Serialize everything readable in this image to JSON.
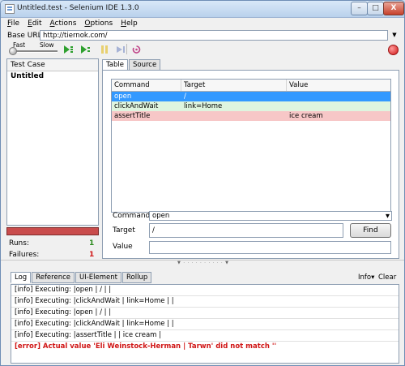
{
  "window": {
    "title": "Untitled.test - Selenium IDE 1.3.0",
    "min": "–",
    "max": "□",
    "close": "X"
  },
  "menu": [
    {
      "accel": "F",
      "rest": "ile"
    },
    {
      "accel": "E",
      "rest": "dit"
    },
    {
      "accel": "A",
      "rest": "ctions"
    },
    {
      "accel": "O",
      "rest": "ptions"
    },
    {
      "accel": "H",
      "rest": "elp"
    }
  ],
  "base_url": {
    "label": "Base URL",
    "value": "http://tiernok.com/"
  },
  "toolbar": {
    "speed_fast": "Fast",
    "speed_slow": "Slow",
    "speed_level": 0
  },
  "test_case": {
    "header": "Test Case",
    "items": [
      "Untitled"
    ]
  },
  "stats": {
    "runs_label": "Runs:",
    "runs": "1",
    "failures_label": "Failures:",
    "failures": "1"
  },
  "editor_tabs": [
    "Table",
    "Source"
  ],
  "table": {
    "headers": [
      "Command",
      "Target",
      "Value"
    ],
    "rows": [
      {
        "command": "open",
        "target": "/",
        "value": ""
      },
      {
        "command": "clickAndWait",
        "target": "link=Home",
        "value": ""
      },
      {
        "command": "assertTitle",
        "target": "",
        "value": "ice cream"
      }
    ]
  },
  "fields": {
    "command_label": "Command",
    "command_value": "open",
    "target_label": "Target",
    "target_value": "/",
    "value_label": "Value",
    "find": "Find"
  },
  "bottom_tabs": [
    "Log",
    "Reference",
    "UI-Element",
    "Rollup"
  ],
  "bottom_controls": {
    "info": "Info▾",
    "clear": "Clear"
  },
  "log": [
    "[info] Executing: |open | / | |",
    "[info] Executing: |clickAndWait | link=Home | |",
    "[info] Executing: |open | / | |",
    "[info] Executing: |clickAndWait | link=Home | |",
    "[info] Executing: |assertTitle | | ice cream |",
    "[error] Actual value 'Eli Weinstock-Herman | Tarwn' did not match ''"
  ],
  "colors": {
    "selected": "#3399ff",
    "passed": "#dff5df",
    "failed": "#f7c7c7",
    "error": "#d01515",
    "success": "#2a8a1c"
  }
}
